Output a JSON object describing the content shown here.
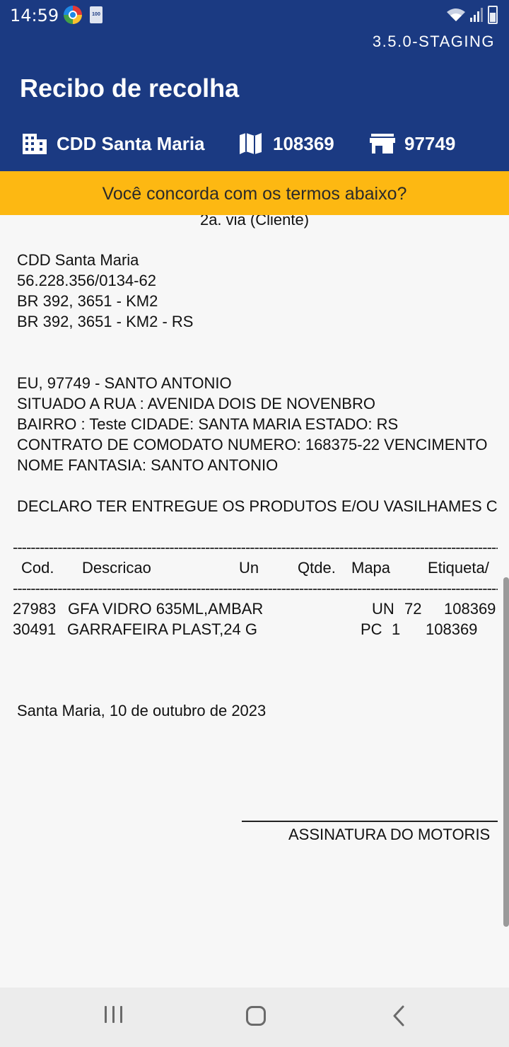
{
  "status_bar": {
    "time": "14:59",
    "battery_saver_label": "100"
  },
  "app_version": "3.5.0-STAGING",
  "title": "Recibo de recolha",
  "info": {
    "unit": "CDD Santa Maria",
    "map": "108369",
    "client": "97749"
  },
  "banner": "Você concorda com os termos abaixo?",
  "receipt": {
    "copy_label": "2a. via (Cliente)",
    "company": {
      "name": "CDD Santa Maria",
      "cnpj": "56.228.356/0134-62",
      "address1": "BR 392, 3651 - KM2",
      "address2": "BR 392, 3651 - KM2 - RS"
    },
    "client_lines": [
      "EU, 97749 - SANTO ANTONIO",
      "SITUADO A RUA : AVENIDA DOIS DE NOVENBRO",
      "BAIRRO : Teste CIDADE: SANTA MARIA ESTADO: RS",
      "CONTRATO DE COMODATO NUMERO: 168375-22 VENCIMENTO",
      "NOME FANTASIA: SANTO ANTONIO"
    ],
    "declaration": "DECLARO TER ENTREGUE OS PRODUTOS E/OU VASILHAMES C",
    "divider": "--------------------------------------------------------------------------------------------------------------------------------------------",
    "table": {
      "headers": {
        "cod": "Cod.",
        "desc": "Descricao",
        "un": "Un",
        "qtde": "Qtde.",
        "mapa": "Mapa",
        "etiqueta": "Etiqueta/"
      },
      "rows": [
        {
          "cod": "27983",
          "desc": "GFA VIDRO 635ML,AMBAR",
          "un": "UN",
          "qtde": "72",
          "mapa": "108369"
        },
        {
          "cod": "30491",
          "desc": "GARRAFEIRA PLAST,24 G",
          "un": "PC",
          "qtde": "1",
          "mapa": "108369"
        }
      ]
    },
    "date_line": "Santa Maria, 10 de outubro de 2023",
    "signature_label": "ASSINATURA DO MOTORIS"
  },
  "colors": {
    "primary": "#1b3a82",
    "banner": "#fdb812",
    "background": "#f7f7f7"
  },
  "icons": {
    "unit": "building-icon",
    "map": "map-icon",
    "client": "store-icon"
  }
}
